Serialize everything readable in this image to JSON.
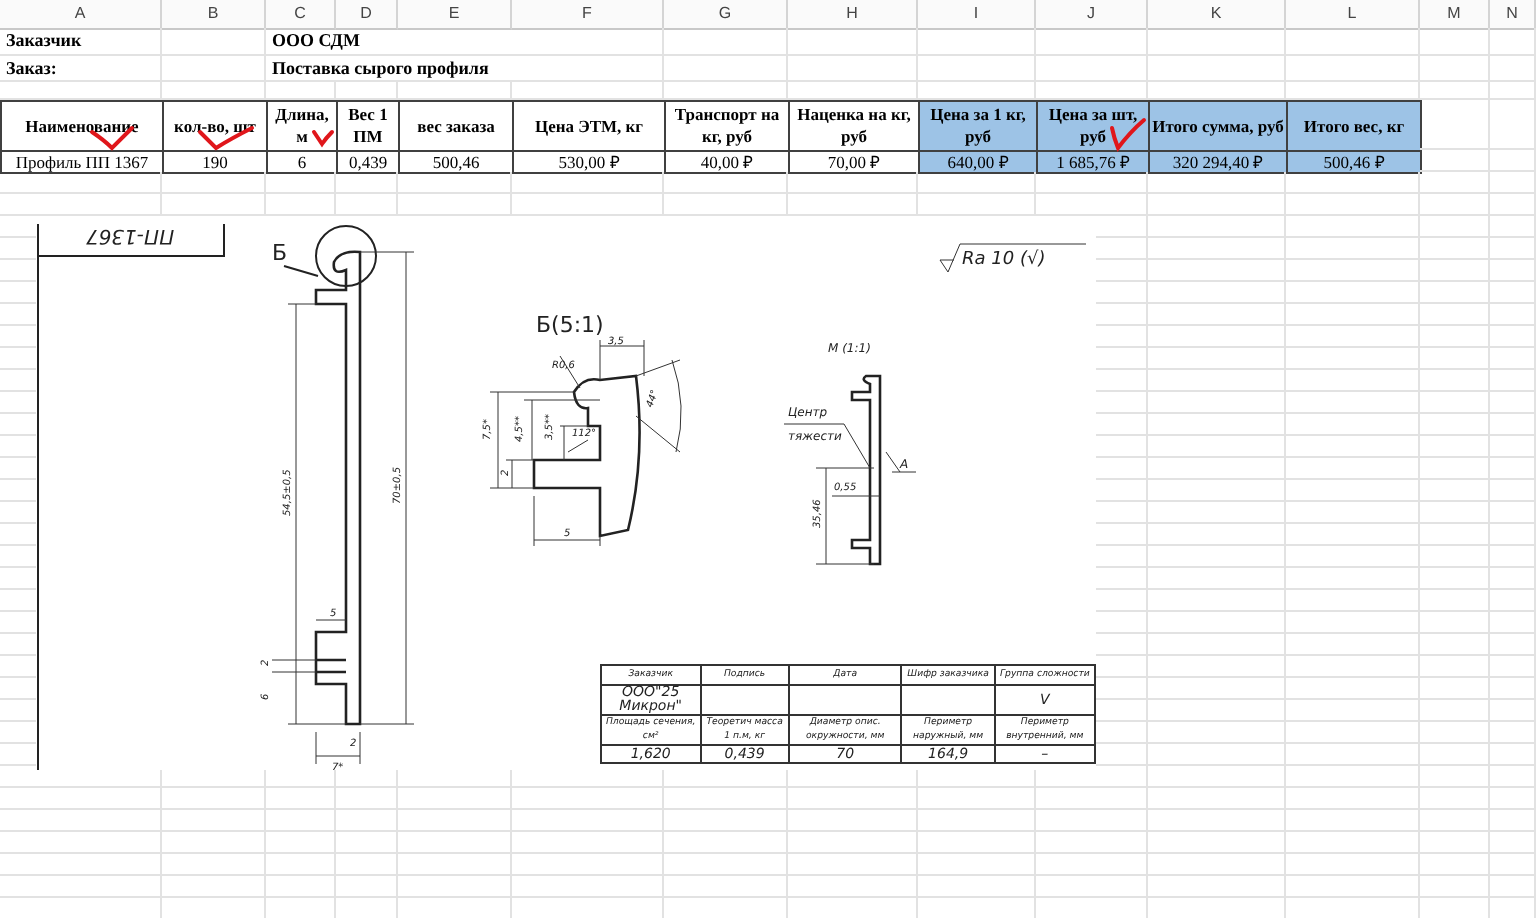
{
  "sheet": {
    "column_letters": [
      "A",
      "B",
      "C",
      "D",
      "E",
      "F",
      "G",
      "H",
      "I",
      "J",
      "K",
      "L",
      "M",
      "N"
    ],
    "info": [
      {
        "label": "Заказчик",
        "value": "ООО СДМ"
      },
      {
        "label": "Заказ:",
        "value": "Поставка сырого профиля"
      }
    ],
    "table": {
      "columns": [
        {
          "label": "Наименование",
          "highlighted": false
        },
        {
          "label": "кол-во, шт",
          "highlighted": false
        },
        {
          "label": "Длина, м",
          "highlighted": false
        },
        {
          "label": "Вес 1 ПМ",
          "highlighted": false
        },
        {
          "label": "вес заказа",
          "highlighted": false
        },
        {
          "label": "Цена ЭТМ, кг",
          "highlighted": false
        },
        {
          "label": "Транспорт на кг, руб",
          "highlighted": false
        },
        {
          "label": "Наценка на кг, руб",
          "highlighted": false
        },
        {
          "label": "Цена за 1 кг, руб",
          "highlighted": true
        },
        {
          "label": "Цена за шт, руб",
          "highlighted": true
        },
        {
          "label": "Итого сумма, руб",
          "highlighted": true
        },
        {
          "label": "Итого вес, кг",
          "highlighted": true
        }
      ],
      "rows": [
        [
          "Профиль ПП 1367",
          "190",
          "6",
          "0,439",
          "500,46",
          "530,00 ₽",
          "40,00 ₽",
          "70,00 ₽",
          "640,00 ₽",
          "1 685,76 ₽",
          "320 294,40 ₽",
          "500,46 ₽"
        ]
      ]
    }
  },
  "drawing": {
    "title": "ПП-1367",
    "labels": [
      {
        "kind": "view",
        "text": "Б"
      },
      {
        "kind": "view",
        "text": "Б(5:1)"
      },
      {
        "kind": "dimension",
        "text": "3,5"
      },
      {
        "kind": "dimension",
        "text": "R0,6"
      },
      {
        "kind": "dimension",
        "text": "44°"
      },
      {
        "kind": "dimension",
        "text": "7,5*"
      },
      {
        "kind": "dimension",
        "text": "4,5**"
      },
      {
        "kind": "dimension",
        "text": "3,5**"
      },
      {
        "kind": "dimension",
        "text": "112°"
      },
      {
        "kind": "dimension",
        "text": "2"
      },
      {
        "kind": "dimension",
        "text": "5"
      },
      {
        "kind": "dimension",
        "text": "54,5±0,5"
      },
      {
        "kind": "dimension",
        "text": "70±0,5"
      },
      {
        "kind": "dimension",
        "text": "5"
      },
      {
        "kind": "dimension",
        "text": "2"
      },
      {
        "kind": "dimension",
        "text": "6"
      },
      {
        "kind": "dimension",
        "text": "2"
      },
      {
        "kind": "dimension",
        "text": "7*"
      },
      {
        "kind": "note",
        "text": "М (1:1)"
      },
      {
        "kind": "note",
        "text": "Центр"
      },
      {
        "kind": "note",
        "text": "тяжести"
      },
      {
        "kind": "note",
        "text": "А"
      },
      {
        "kind": "dimension",
        "text": "0,55"
      },
      {
        "kind": "dimension",
        "text": "35,46"
      },
      {
        "kind": "roughness",
        "text": "Ra 10 (√)"
      }
    ],
    "title_block": {
      "headings_1": [
        "Заказчик",
        "Подпись",
        "Дата",
        "Шифр заказчика",
        "Группа сложности"
      ],
      "values_1": {
        "customer": "ООО\"25 Микрон\"",
        "complexity_group": "V"
      },
      "headings_2": [
        "Площадь сечения, см²",
        "Теоретич масса 1 п.м, кг",
        "Диаметр опис. окружности, мм",
        "Периметр наружный, мм",
        "Периметр внутренний, мм"
      ],
      "values_2": [
        "1,620",
        "0,439",
        "70",
        "164,9",
        "–"
      ]
    }
  }
}
